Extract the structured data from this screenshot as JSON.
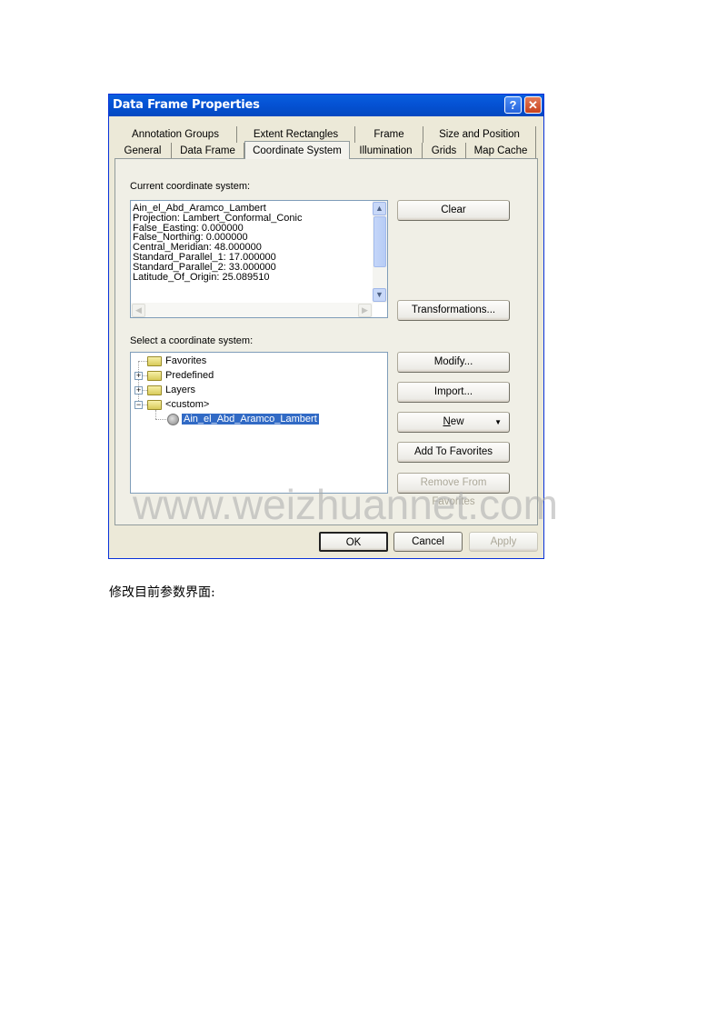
{
  "dialog": {
    "title": "Data Frame Properties",
    "help_icon": "help-icon",
    "close_icon": "close-icon",
    "tabs_row1": [
      {
        "label": "Annotation Groups"
      },
      {
        "label": "Extent Rectangles"
      },
      {
        "label": "Frame"
      },
      {
        "label": "Size and Position"
      }
    ],
    "tabs_row2": [
      {
        "label": "General"
      },
      {
        "label": "Data Frame"
      },
      {
        "label": "Coordinate System",
        "active": true
      },
      {
        "label": "Illumination"
      },
      {
        "label": "Grids"
      },
      {
        "label": "Map Cache"
      }
    ],
    "current": {
      "label": "Current coordinate system:",
      "lines": [
        "Ain_el_Abd_Aramco_Lambert",
        "Projection: Lambert_Conformal_Conic",
        "False_Easting: 0.000000",
        "False_Northing: 0.000000",
        "Central_Meridian: 48.000000",
        "Standard_Parallel_1: 17.000000",
        "Standard_Parallel_2: 33.000000",
        "Latitude_Of_Origin: 25.089510"
      ],
      "clear_label": "Clear",
      "transformations_label": "Transformations..."
    },
    "select": {
      "label": "Select a coordinate system:",
      "tree": [
        {
          "label": "Favorites",
          "icon": "folder-icon"
        },
        {
          "label": "Predefined",
          "icon": "folder-icon",
          "expander": "+"
        },
        {
          "label": "Layers",
          "icon": "folder-icon",
          "expander": "+"
        },
        {
          "label": "<custom>",
          "icon": "folder-icon",
          "expander": "−"
        },
        {
          "label": "Ain_el_Abd_Aramco_Lambert",
          "icon": "globe-icon",
          "selected": true
        }
      ],
      "modify_label": "Modify...",
      "import_label": "Import...",
      "new_label_u": "N",
      "new_label_rest": "ew",
      "new_dropdown": "▼",
      "add_favorites_label": "Add To Favorites",
      "remove_favorites_label": "Remove From Favorites"
    },
    "footer": {
      "ok_label": "OK",
      "cancel_label": "Cancel",
      "apply_label": "Apply"
    }
  },
  "watermark": "www.weizhuannet.com",
  "caption": "修改目前参数界面:"
}
